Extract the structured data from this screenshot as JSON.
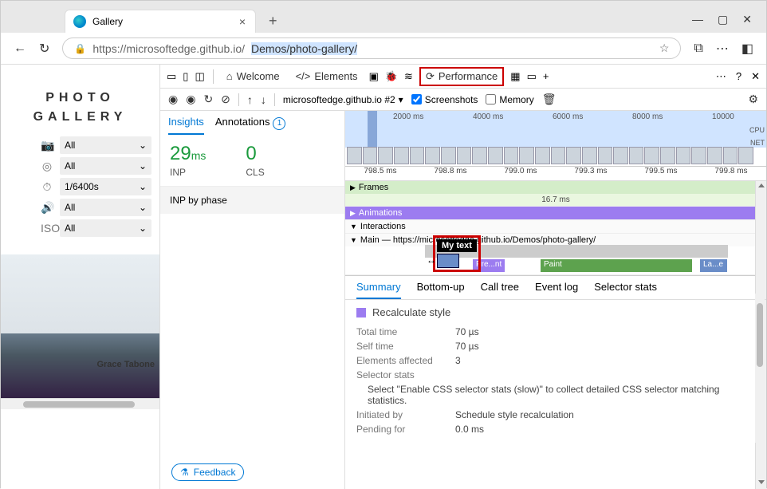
{
  "window": {
    "tab_title": "Gallery",
    "min": "—",
    "restore": "▢",
    "close": "✕",
    "new_tab": "+"
  },
  "addressbar": {
    "back": "←",
    "reload": "↻",
    "lock": "🔒",
    "url_prefix": "https://microsoftedge.github.io/",
    "url_selected": "Demos/photo-gallery/",
    "star": "☆",
    "ext": "⧉",
    "more": "⋯",
    "split": "◧"
  },
  "page": {
    "title_line1": "PHOTO",
    "title_line2": "GALLERY",
    "filters": [
      {
        "icon": "📷",
        "value": "All"
      },
      {
        "icon": "◎",
        "value": "All"
      },
      {
        "icon": "⏱",
        "value": "1/6400s"
      },
      {
        "icon": "🔊",
        "value": "All"
      },
      {
        "icon": "ISO",
        "value": "All"
      }
    ],
    "credit": "Grace Tabone"
  },
  "devtools": {
    "tabs": {
      "welcome": "Welcome",
      "elements": "Elements",
      "performance": "Performance"
    },
    "toolbar": {
      "context": "microsoftedge.github.io #2",
      "screenshots": "Screenshots",
      "memory": "Memory"
    },
    "insights": {
      "tab_insights": "Insights",
      "tab_annotations": "Annotations",
      "annotation_count": "1",
      "inp_value": "29",
      "inp_unit": "ms",
      "inp_label": "INP",
      "cls_value": "0",
      "cls_label": "CLS",
      "inp_phase": "INP by phase",
      "feedback": "Feedback"
    },
    "overview": {
      "ticks": [
        "2000 ms",
        "4000 ms",
        "6000 ms",
        "8000 ms",
        "10000"
      ],
      "side_labels": [
        "CPU",
        "NET"
      ]
    },
    "ruler": [
      "798.5 ms",
      "798.8 ms",
      "799.0 ms",
      "799.3 ms",
      "799.5 ms",
      "799.8 ms"
    ],
    "tracks": {
      "frames_label": "Frames",
      "frames_value": "16.7 ms",
      "animations": "Animations",
      "interactions": "Interactions",
      "main": "Main — https://microsoftedge.github.io/Demos/photo-gallery/",
      "tooltip": "My text",
      "flame_prent": "Pre...nt",
      "flame_paint": "Paint",
      "flame_lae": "La...e"
    },
    "details": {
      "tabs": [
        "Summary",
        "Bottom-up",
        "Call tree",
        "Event log",
        "Selector stats"
      ],
      "title": "Recalculate style",
      "total_time_l": "Total time",
      "total_time_v": "70 µs",
      "self_time_l": "Self time",
      "self_time_v": "70 µs",
      "elements_l": "Elements affected",
      "elements_v": "3",
      "selector_l": "Selector stats",
      "selector_v": "Select \"Enable CSS selector stats (slow)\" to collect detailed CSS selector matching statistics.",
      "initiated_l": "Initiated by",
      "initiated_v": "Schedule style recalculation",
      "pending_l": "Pending for",
      "pending_v": "0.0 ms"
    }
  }
}
